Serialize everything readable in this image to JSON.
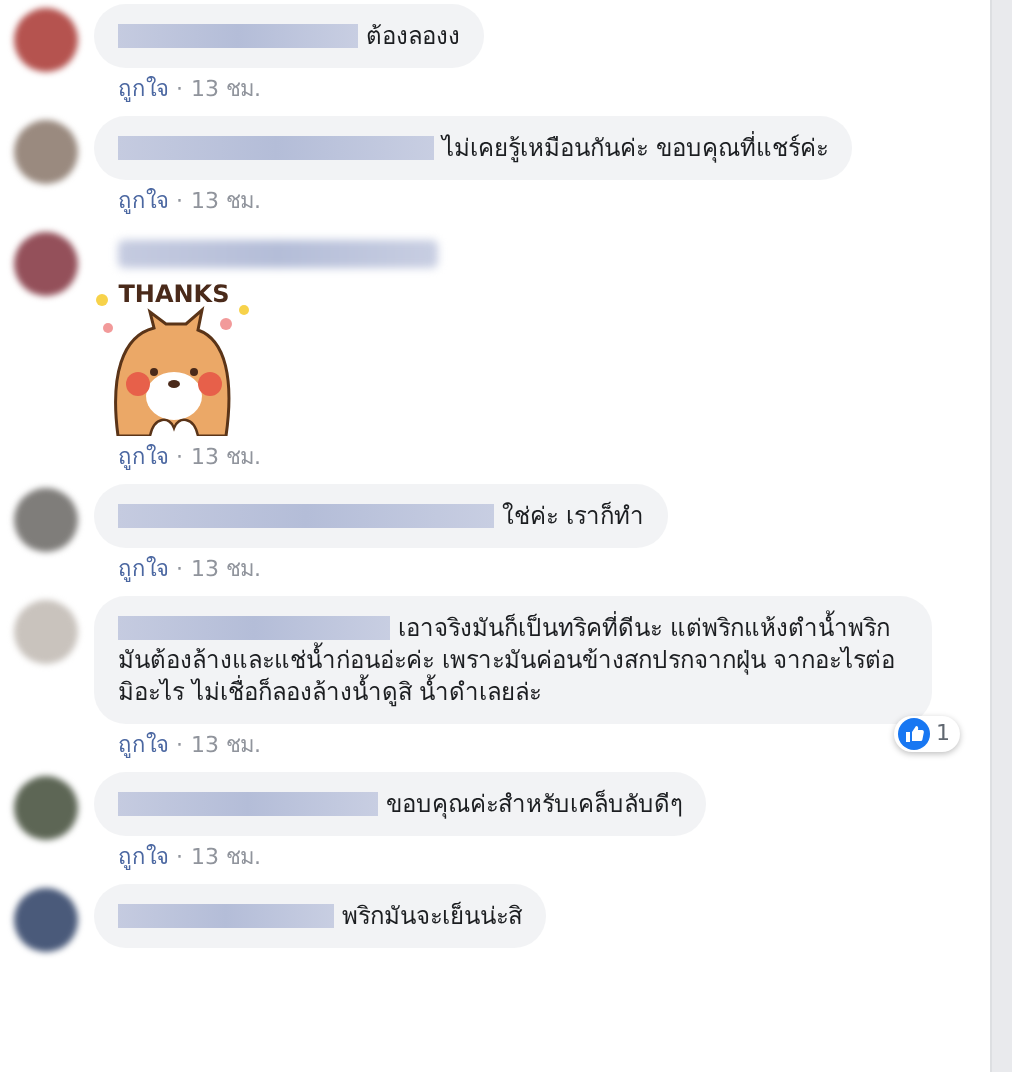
{
  "comments": [
    {
      "kind": "text",
      "text": "ต้องลองง",
      "like_label": "ถูกใจ",
      "separator": "·",
      "time": "13 ชม."
    },
    {
      "kind": "text",
      "text": "ไม่เคยรู้เหมือนกันค่ะ ขอบคุณที่แชร์ค่ะ",
      "like_label": "ถูกใจ",
      "separator": "·",
      "time": "13 ชม."
    },
    {
      "kind": "sticker",
      "sticker_text": "THANKS",
      "like_label": "ถูกใจ",
      "separator": "·",
      "time": "13 ชม."
    },
    {
      "kind": "text",
      "text": "ใช่ค่ะ เราก็ทำ",
      "like_label": "ถูกใจ",
      "separator": "·",
      "time": "13 ชม."
    },
    {
      "kind": "text",
      "text": "เอาจริงมันก็เป็นทริคที่ดีนะ แต่พริกแห้งตำน้ำพริกมันต้องล้างและแช่น้ำก่อนอ่ะค่ะ เพราะมันค่อนข้างสกปรกจากฝุ่น จากอะไรต่อมิอะไร ไม่เชื่อก็ลองล้างน้ำดูสิ น้ำดำเลยล่ะ",
      "reaction_count": "1",
      "like_label": "ถูกใจ",
      "separator": "·",
      "time": "13 ชม."
    },
    {
      "kind": "text",
      "text": "ขอบคุณค่ะสำหรับเคล็บลับดีๆ",
      "like_label": "ถูกใจ",
      "separator": "·",
      "time": "13 ชม."
    },
    {
      "kind": "text",
      "text": "พริกมันจะเย็นน่ะสิ"
    }
  ]
}
